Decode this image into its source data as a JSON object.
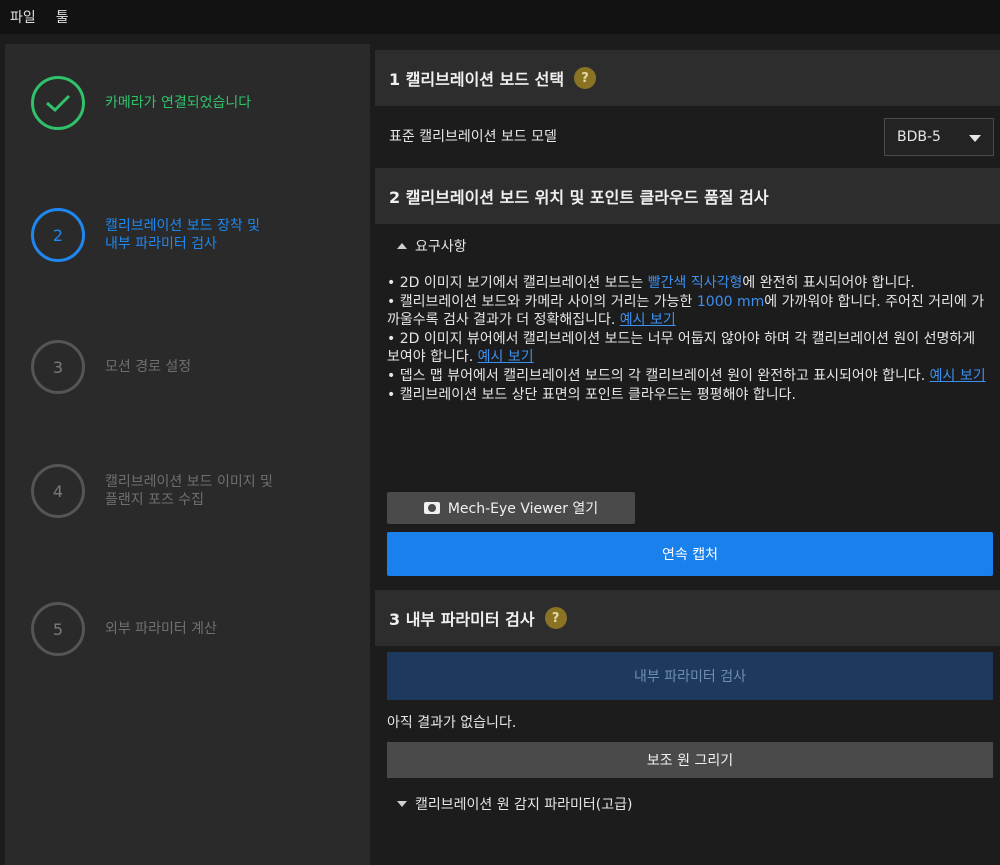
{
  "menu": {
    "file": "파일",
    "tools": "툴"
  },
  "sidebar": {
    "steps": [
      {
        "number": "✓",
        "label": "카메라가 연결되었습니다",
        "state": "done"
      },
      {
        "number": "2",
        "label_lines": [
          "캘리브레이션 보드 장착 및",
          "내부 파라미터 검사"
        ],
        "state": "active"
      },
      {
        "number": "3",
        "label": "모션 경로 설정",
        "state": "pending"
      },
      {
        "number": "4",
        "label_lines": [
          "캘리브레이션 보드 이미지 및",
          "플랜지 포즈 수집"
        ],
        "state": "pending"
      },
      {
        "number": "5",
        "label": "외부 파라미터 계산",
        "state": "pending"
      }
    ]
  },
  "section1": {
    "title": "1 캘리브레이션 보드 선택",
    "help": "?",
    "model_label": "표준 캘리브레이션 보드 모델",
    "model_value": "BDB-5"
  },
  "section2": {
    "title": "2 캘리브레이션 보드 위치 및 포인트 클라우드 품질 검사",
    "requirements_toggle": "요구사항",
    "req1_a": "• 2D 이미지 보기에서 캘리브레이션 보드는 ",
    "req1_highlight": "빨간색 직사각형",
    "req1_b": "에 완전히 표시되어야 합니다.",
    "req2_a": "• 캘리브레이션 보드와 카메라 사이의 거리는 가능한 ",
    "req2_highlight": "1000 mm",
    "req2_b": "에 가까워야 합니다. 주어진 거리에 가까울수록 검사 결과가 더 정확해집니다. ",
    "req2_link": "예시 보기",
    "req3_a": "• 2D 이미지 뷰어에서 캘리브레이션 보드는 너무 어둡지 않아야 하며 각 캘리브레이션 원이 선명하게 보여야 합니다. ",
    "req3_link": "예시 보기",
    "req4_a": "• 뎁스 맵 뷰어에서 캘리브레이션 보드의 각 캘리브레이션 원이 완전하고 표시되어야 합니다. ",
    "req4_link": "예시 보기",
    "req5": "• 캘리브레이션 보드 상단 표면의 포인트 클라우드는 평평해야 합니다.",
    "viewer_button": "Mech-Eye Viewer 열기",
    "capture_button": "연속 캡처"
  },
  "section3": {
    "title": "3 내부 파라미터 검사",
    "help": "?",
    "check_button": "내부 파라미터 검사",
    "no_result": "아직 결과가 없습니다.",
    "aux_button": "보조 원 그리기",
    "advanced_toggle": "캘리브레이션 원 감지 파라미터(고급)"
  },
  "colors": {
    "active": "#1e88f0",
    "done": "#2fc26b",
    "primary_button": "#1a80ec",
    "help_badge": "#8a7424"
  }
}
